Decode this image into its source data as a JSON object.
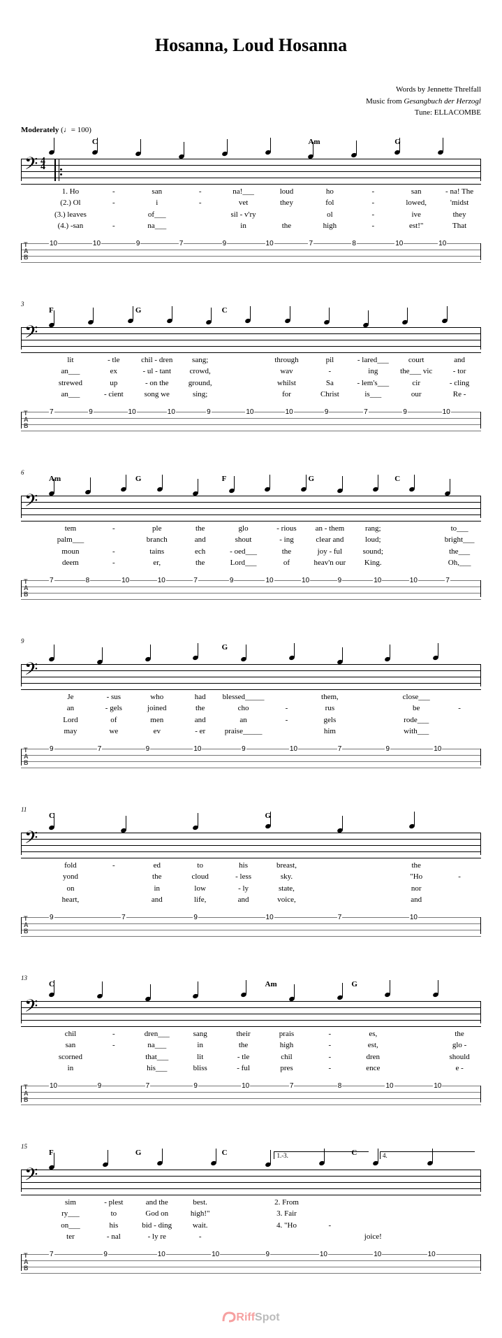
{
  "title": "Hosanna, Loud Hosanna",
  "credits": {
    "words": "Words by Jennette Threlfall",
    "music_prefix": "Music from ",
    "music_source": "Gesangbuch der Herzogl",
    "tune": "Tune: ELLACOMBE"
  },
  "tempo": {
    "label": "Moderately",
    "marking": "(♩= 100)"
  },
  "time_sig_top": "4",
  "time_sig_bot": "4",
  "systems": [
    {
      "measure": null,
      "chords": [
        "",
        "C",
        "",
        "",
        "",
        "",
        "Am",
        "",
        "G",
        ""
      ],
      "lyrics": [
        [
          "1. Ho",
          "-",
          "san",
          "-",
          "na!___",
          "loud",
          "ho",
          "-",
          "san",
          "- na!  The"
        ],
        [
          "(2.) Ol",
          "-",
          "i",
          "-",
          "vet",
          "they",
          "fol",
          "-",
          "lowed,",
          "'midst"
        ],
        [
          "(3.) leaves",
          "",
          "of___",
          "",
          "sil  - v'ry",
          "",
          "ol",
          "-",
          "ive",
          "they"
        ],
        [
          "(4.) -san",
          "-",
          "na___",
          "",
          "in",
          "the",
          "high",
          "-",
          "est!\"",
          "That"
        ]
      ],
      "tabs": [
        {
          "s": 1,
          "f": "10"
        },
        {
          "s": 1,
          "f": "10"
        },
        {
          "s": 1,
          "f": "9"
        },
        {
          "s": 1,
          "f": "7"
        },
        {
          "s": 1,
          "f": "9"
        },
        {
          "s": 1,
          "f": "10"
        },
        {
          "s": 1,
          "f": "7"
        },
        {
          "s": 1,
          "f": "8"
        },
        {
          "s": 1,
          "f": "10"
        },
        {
          "s": 1,
          "f": "10"
        }
      ],
      "first": true
    },
    {
      "measure": "3",
      "chords": [
        "F",
        "",
        "G",
        "",
        "C",
        "",
        "",
        "",
        "",
        ""
      ],
      "lyrics": [
        [
          "lit",
          "- tle",
          "chil  -  dren",
          "sang;",
          "",
          "through",
          "pil",
          "- lared___",
          "court",
          "and"
        ],
        [
          "an___",
          "ex",
          "- ul  -  tant",
          "crowd,",
          "",
          "wav",
          "-",
          "ing",
          "the___ vic",
          "- tor"
        ],
        [
          "strewed",
          "up",
          "- on   the",
          "ground,",
          "",
          "whilst",
          "Sa",
          "- lem's___",
          "cir",
          "- cling"
        ],
        [
          "an___",
          "- cient",
          "song   we",
          "sing;",
          "",
          "for",
          "Christ",
          "is___",
          "our",
          "Re  -"
        ]
      ],
      "tabs": [
        {
          "s": 1,
          "f": "7"
        },
        {
          "s": 1,
          "f": "9"
        },
        {
          "s": 1,
          "f": "10"
        },
        {
          "s": 1,
          "f": "10"
        },
        {
          "s": 1,
          "f": "9"
        },
        {
          "s": 1,
          "f": "10"
        },
        {
          "s": 1,
          "f": "10"
        },
        {
          "s": 1,
          "f": "9"
        },
        {
          "s": 1,
          "f": "7"
        },
        {
          "s": 1,
          "f": "9"
        },
        {
          "s": 1,
          "f": "10"
        }
      ]
    },
    {
      "measure": "6",
      "chords": [
        "Am",
        "",
        "G",
        "",
        "F",
        "",
        "G",
        "",
        "C",
        ""
      ],
      "lyrics": [
        [
          "tem",
          "-",
          "ple",
          "the",
          "glo",
          "- rious",
          "an  -  them",
          "rang;",
          "",
          "to___"
        ],
        [
          "palm___",
          "",
          "branch",
          "and",
          "shout",
          "- ing",
          "clear   and",
          "loud;",
          "",
          "bright___"
        ],
        [
          "moun",
          "-",
          "tains",
          "ech",
          "- oed___",
          "the",
          "joy  -  ful",
          "sound;",
          "",
          "the___"
        ],
        [
          "deem",
          "-",
          "er,",
          "the",
          "Lord___",
          "of",
          "heav'n   our",
          "King.",
          "",
          "Oh,___"
        ]
      ],
      "tabs": [
        {
          "s": 1,
          "f": "7"
        },
        {
          "s": 1,
          "f": "8"
        },
        {
          "s": 1,
          "f": "10"
        },
        {
          "s": 1,
          "f": "10"
        },
        {
          "s": 1,
          "f": "7"
        },
        {
          "s": 1,
          "f": "9"
        },
        {
          "s": 1,
          "f": "10"
        },
        {
          "s": 1,
          "f": "10"
        },
        {
          "s": 1,
          "f": "9"
        },
        {
          "s": 1,
          "f": "10"
        },
        {
          "s": 1,
          "f": "10"
        },
        {
          "s": 1,
          "f": "7"
        }
      ]
    },
    {
      "measure": "9",
      "chords": [
        "",
        "",
        "",
        "",
        "G",
        "",
        "",
        "",
        "",
        ""
      ],
      "lyrics": [
        [
          "Je",
          "- sus",
          "who",
          "had",
          "blessed_____",
          "",
          "them,",
          "",
          "close___",
          ""
        ],
        [
          "an",
          "- gels",
          "joined",
          "the",
          "cho",
          "-",
          "rus",
          "",
          "be",
          "-"
        ],
        [
          "Lord",
          "of",
          "men",
          "and",
          "an",
          "-",
          "gels",
          "",
          "rode___",
          ""
        ],
        [
          "may",
          "we",
          "ev",
          "- er",
          "praise_____",
          "",
          "him",
          "",
          "with___",
          ""
        ]
      ],
      "tabs": [
        {
          "s": 1,
          "f": "9"
        },
        {
          "s": 1,
          "f": "7"
        },
        {
          "s": 1,
          "f": "9"
        },
        {
          "s": 1,
          "f": "10"
        },
        {
          "s": 1,
          "f": "9"
        },
        {
          "s": 1,
          "f": "10"
        },
        {
          "s": 1,
          "f": "7"
        },
        {
          "s": 1,
          "f": "9"
        },
        {
          "s": 1,
          "f": "10"
        }
      ]
    },
    {
      "measure": "11",
      "chords": [
        "C",
        "",
        "",
        "",
        "",
        "G",
        "",
        "",
        "",
        ""
      ],
      "lyrics": [
        [
          "fold",
          "-",
          "ed",
          "to",
          "his",
          "breast,",
          "",
          "",
          "the",
          ""
        ],
        [
          "yond",
          "",
          "the",
          "cloud",
          "- less",
          "sky.",
          "",
          "",
          "\"Ho",
          "-"
        ],
        [
          "on",
          "",
          "in",
          "low",
          "- ly",
          "state,",
          "",
          "",
          "nor",
          ""
        ],
        [
          "heart,",
          "",
          "and",
          "life,",
          "and",
          "voice,",
          "",
          "",
          "and",
          ""
        ]
      ],
      "tabs": [
        {
          "s": 1,
          "f": "9"
        },
        {
          "s": 1,
          "f": "7"
        },
        {
          "s": 1,
          "f": "9"
        },
        {
          "s": 1,
          "f": "10"
        },
        {
          "s": 1,
          "f": "7"
        },
        {
          "s": 1,
          "f": "10"
        }
      ]
    },
    {
      "measure": "13",
      "chords": [
        "C",
        "",
        "",
        "",
        "",
        "Am",
        "",
        "G",
        "",
        ""
      ],
      "lyrics": [
        [
          "chil",
          "-",
          "dren___",
          "sang",
          "their",
          "prais",
          "-",
          "es,",
          "",
          "the"
        ],
        [
          "san",
          "-",
          "na___",
          "in",
          "the",
          "high",
          "-",
          "est,",
          "",
          "glo  -"
        ],
        [
          "scorned",
          "",
          "that___",
          "lit",
          "- tle",
          "chil",
          "-",
          "dren",
          "",
          "should"
        ],
        [
          "in",
          "",
          "his___",
          "bliss",
          "- ful",
          "pres",
          "-",
          "ence",
          "",
          "e    -"
        ]
      ],
      "tabs": [
        {
          "s": 1,
          "f": "10"
        },
        {
          "s": 1,
          "f": "9"
        },
        {
          "s": 1,
          "f": "7"
        },
        {
          "s": 1,
          "f": "9"
        },
        {
          "s": 1,
          "f": "10"
        },
        {
          "s": 1,
          "f": "7"
        },
        {
          "s": 1,
          "f": "8"
        },
        {
          "s": 1,
          "f": "10"
        },
        {
          "s": 1,
          "f": "10"
        }
      ]
    },
    {
      "measure": "15",
      "chords": [
        "F",
        "",
        "G",
        "",
        "C",
        "",
        "",
        "C",
        "",
        ""
      ],
      "endings": [
        "1.-3.",
        "4."
      ],
      "lyrics": [
        [
          "sim",
          "- plest",
          "and   the",
          "best.",
          "",
          "2. From",
          "",
          "",
          "",
          ""
        ],
        [
          "ry___",
          "to",
          "God   on",
          "high!\"",
          "",
          "3. Fair",
          "",
          "",
          "",
          ""
        ],
        [
          "on___",
          "his",
          "bid  -  ding",
          "wait.",
          "",
          "4. \"Ho",
          "-",
          "",
          "",
          ""
        ],
        [
          "ter",
          "- nal",
          "- ly   re",
          "-",
          "",
          "",
          "",
          "joice!",
          "",
          ""
        ]
      ],
      "tabs": [
        {
          "s": 1,
          "f": "7"
        },
        {
          "s": 1,
          "f": "9"
        },
        {
          "s": 1,
          "f": "10"
        },
        {
          "s": 1,
          "f": "10"
        },
        {
          "s": 1,
          "f": "9"
        },
        {
          "s": 1,
          "f": "10"
        },
        {
          "s": 1,
          "f": "10"
        },
        {
          "s": 1,
          "f": "10"
        }
      ]
    }
  ],
  "watermark": "RiffSpot"
}
